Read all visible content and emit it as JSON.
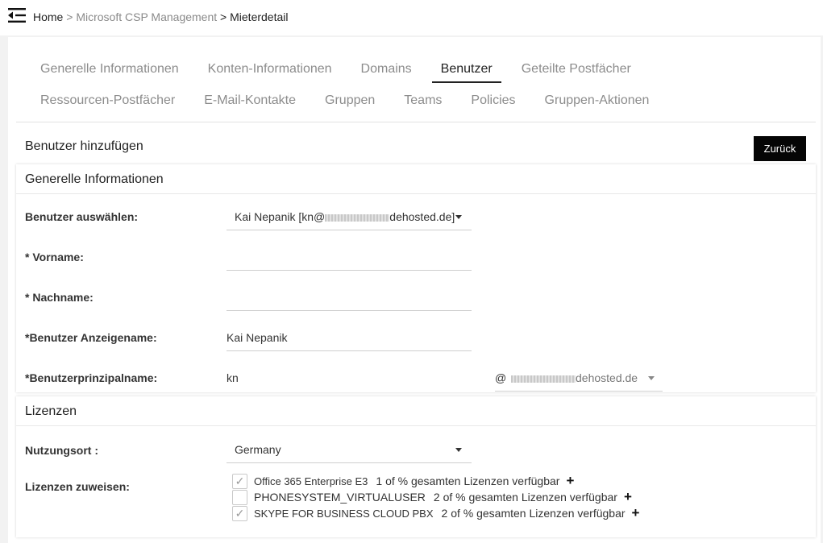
{
  "breadcrumb": {
    "home": "Home",
    "sep1": ">",
    "mid": "Microsoft CSP Management",
    "sep2": ">",
    "current": "Mieterdetail"
  },
  "tabs_row1": [
    {
      "label": "Generelle Informationen",
      "active": false
    },
    {
      "label": "Konten-Informationen",
      "active": false
    },
    {
      "label": "Domains",
      "active": false
    },
    {
      "label": "Benutzer",
      "active": true
    },
    {
      "label": "Geteilte Postfächer",
      "active": false
    }
  ],
  "tabs_row2": [
    {
      "label": "Ressourcen-Postfächer"
    },
    {
      "label": "E-Mail-Kontakte"
    },
    {
      "label": "Gruppen"
    },
    {
      "label": "Teams"
    },
    {
      "label": "Policies"
    },
    {
      "label": "Gruppen-Aktionen"
    }
  ],
  "page_section_title": "Benutzer hinzufügen",
  "back_button": "Zurück",
  "general": {
    "title": "Generelle Informationen",
    "select_user_label": "Benutzer auswählen:",
    "select_user_prefix": "Kai Nepanik [kn@",
    "select_user_suffix": "dehosted.de]",
    "first_name_label": "* Vorname:",
    "first_name_value": "",
    "last_name_label": "* Nachname:",
    "last_name_value": "",
    "display_name_label": "*Benutzer Anzeigename:",
    "display_name_value": "Kai Nepanik",
    "upn_label": "*Benutzerprinzipalname:",
    "upn_value": "kn",
    "upn_at": "@",
    "upn_domain_suffix": "dehosted.de"
  },
  "licenses": {
    "title": "Lizenzen",
    "usage_location_label": "Nutzungsort :",
    "usage_location_value": "Germany",
    "assign_label": "Lizenzen zuweisen:",
    "items": [
      {
        "name": "Office 365 Enterprise E3",
        "availability": "1 of % gesamten Lizenzen verfügbar",
        "checked": true
      },
      {
        "name": "PHONESYSTEM_VIRTUALUSER",
        "availability": "2 of % gesamten Lizenzen verfügbar",
        "checked": false
      },
      {
        "name": "SKYPE FOR BUSINESS CLOUD PBX",
        "availability": "2 of % gesamten Lizenzen verfügbar",
        "checked": true
      }
    ],
    "check_glyph": "✓",
    "plus_glyph": "+"
  },
  "colors": {
    "accent_button": "#050505",
    "tab_active": "#222222",
    "tab_inactive": "#8c8c8c"
  },
  "icons": {
    "menu": "menu-collapse-icon",
    "dropdown": "chevron-down-icon",
    "add": "plus-icon",
    "check": "check-icon"
  }
}
